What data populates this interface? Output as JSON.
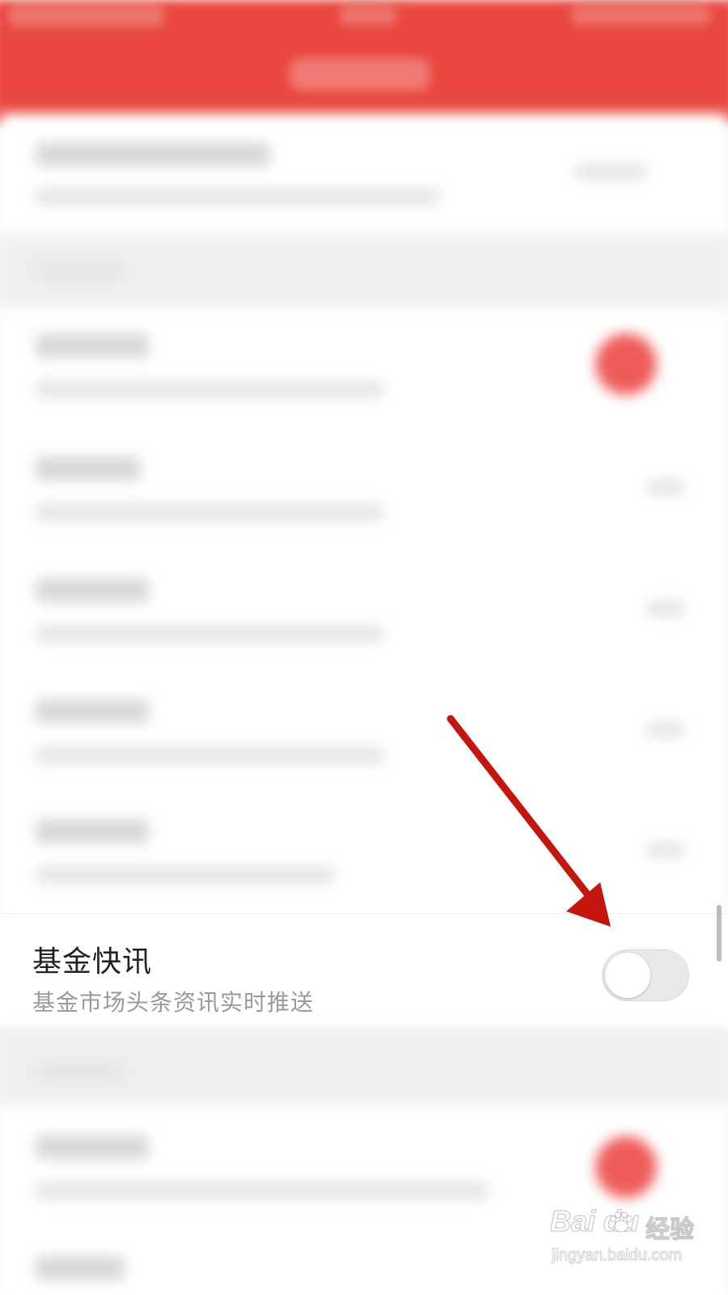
{
  "colors": {
    "header_red": "#e9473f",
    "toggle_off_track": "#e9e9e9",
    "arrow_red": "#c4160e",
    "title_text": "#222222",
    "subtitle_text": "#9a9a9a"
  },
  "focused_row": {
    "title": "基金快讯",
    "subtitle": "基金市场头条资讯实时推送",
    "toggle_on": false
  },
  "watermark": {
    "logo": "Bai  du",
    "cn": "经验",
    "url": "jingyan.baidu.com"
  },
  "icons": {
    "annotation_arrow": "arrow-icon",
    "toggle": "toggle-switch"
  }
}
